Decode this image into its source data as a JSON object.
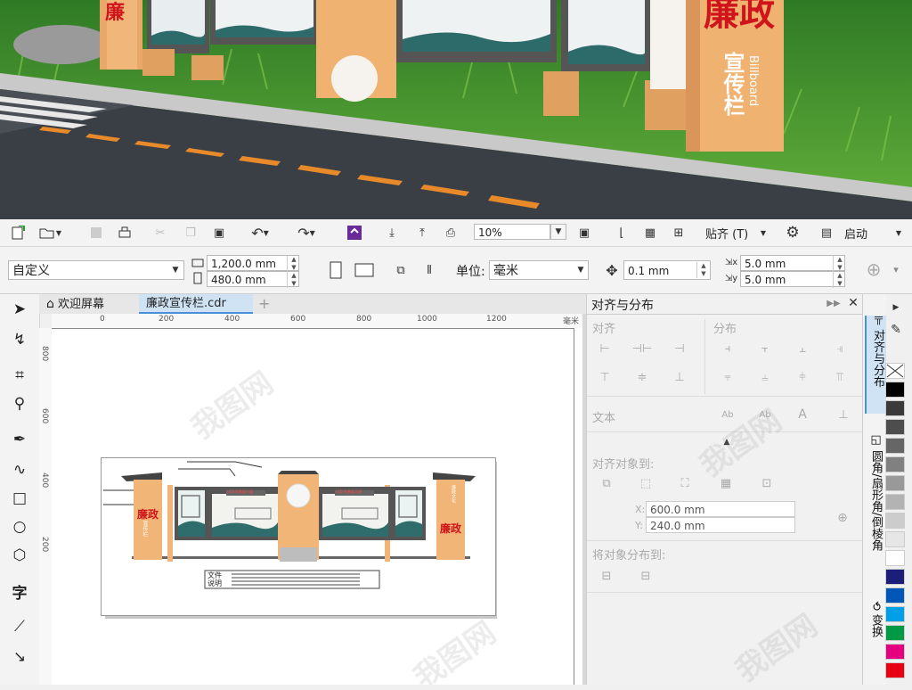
{
  "scene": {
    "sign_title": "廉政",
    "sign_subtitle": "宣传栏",
    "sign_english": "Billboard",
    "left_sign_text": "廉"
  },
  "toolbar1": {
    "zoom_value": "10%",
    "snap_label": "贴齐 (T)",
    "launch_label": "启动"
  },
  "toolbar2": {
    "page_size": "自定义",
    "width": "1,200.0 mm",
    "height": "480.0 mm",
    "unit_label": "单位:",
    "unit_value": "毫米",
    "nudge": "0.1 mm",
    "dup_x": "5.0 mm",
    "dup_y": "5.0 mm"
  },
  "tabs": [
    {
      "label": "欢迎屏幕"
    },
    {
      "label": "廉政宣传栏.cdr"
    }
  ],
  "hruler": {
    "ticks": [
      "0",
      "200",
      "400",
      "600",
      "800",
      "1000",
      "1200"
    ],
    "unit": "毫米"
  },
  "vruler": {
    "ticks": [
      "800",
      "600",
      "400",
      "200"
    ]
  },
  "design": {
    "led_text": "LED 形象展示窗",
    "panel_left": "廉政",
    "panel_left_sub": "宣传栏",
    "caption_top": "文件",
    "caption_bottom": "说明",
    "pillar_top_text": "廉政文化"
  },
  "docker": {
    "title": "对齐与分布",
    "align_label": "对齐",
    "distribute_label": "分布",
    "text_label": "文本",
    "align_to_label": "对齐对象到:",
    "x_label": "X:",
    "x_value": "600.0 mm",
    "y_label": "Y:",
    "y_value": "240.0 mm",
    "distribute_to_label": "将对象分布到:"
  },
  "side_tabs": [
    {
      "label": "对齐与分布"
    },
    {
      "label": "圆角/扇形角/倒棱角"
    },
    {
      "label": "变换"
    }
  ],
  "palette": {
    "colors": [
      "#ffffff",
      "#000000",
      "#3a3a3a",
      "#4d4d4d",
      "#666666",
      "#808080",
      "#999999",
      "#b3b3b3",
      "#cccccc",
      "#e6e6e6",
      "#ffffff",
      "#1d1d7a",
      "#0057b8",
      "#00a0e9",
      "#009944",
      "#e4007f",
      "#e60012"
    ]
  },
  "watermark": "我图网"
}
